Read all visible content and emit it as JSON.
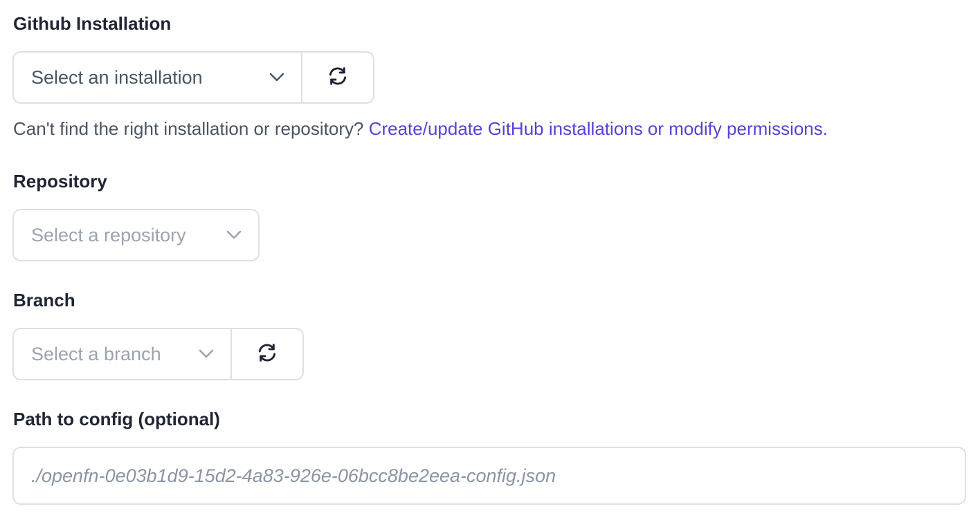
{
  "installation": {
    "label": "Github Installation",
    "placeholder": "Select an installation",
    "help_text": "Can't find the right installation or repository? ",
    "help_link": "Create/update GitHub installations or modify permissions."
  },
  "repository": {
    "label": "Repository",
    "placeholder": "Select a repository"
  },
  "branch": {
    "label": "Branch",
    "placeholder": "Select a branch"
  },
  "config_path": {
    "label": "Path to config (optional)",
    "placeholder": "./openfn-0e03b1d9-15d2-4a83-926e-06bcc8be2eea-config.json",
    "value": ""
  },
  "icons": {
    "dropdown": "chevron-down-icon",
    "refresh": "refresh-icon"
  },
  "colors": {
    "link": "#5b3fd6",
    "border": "#dcdfe4",
    "label": "#1f2533"
  }
}
